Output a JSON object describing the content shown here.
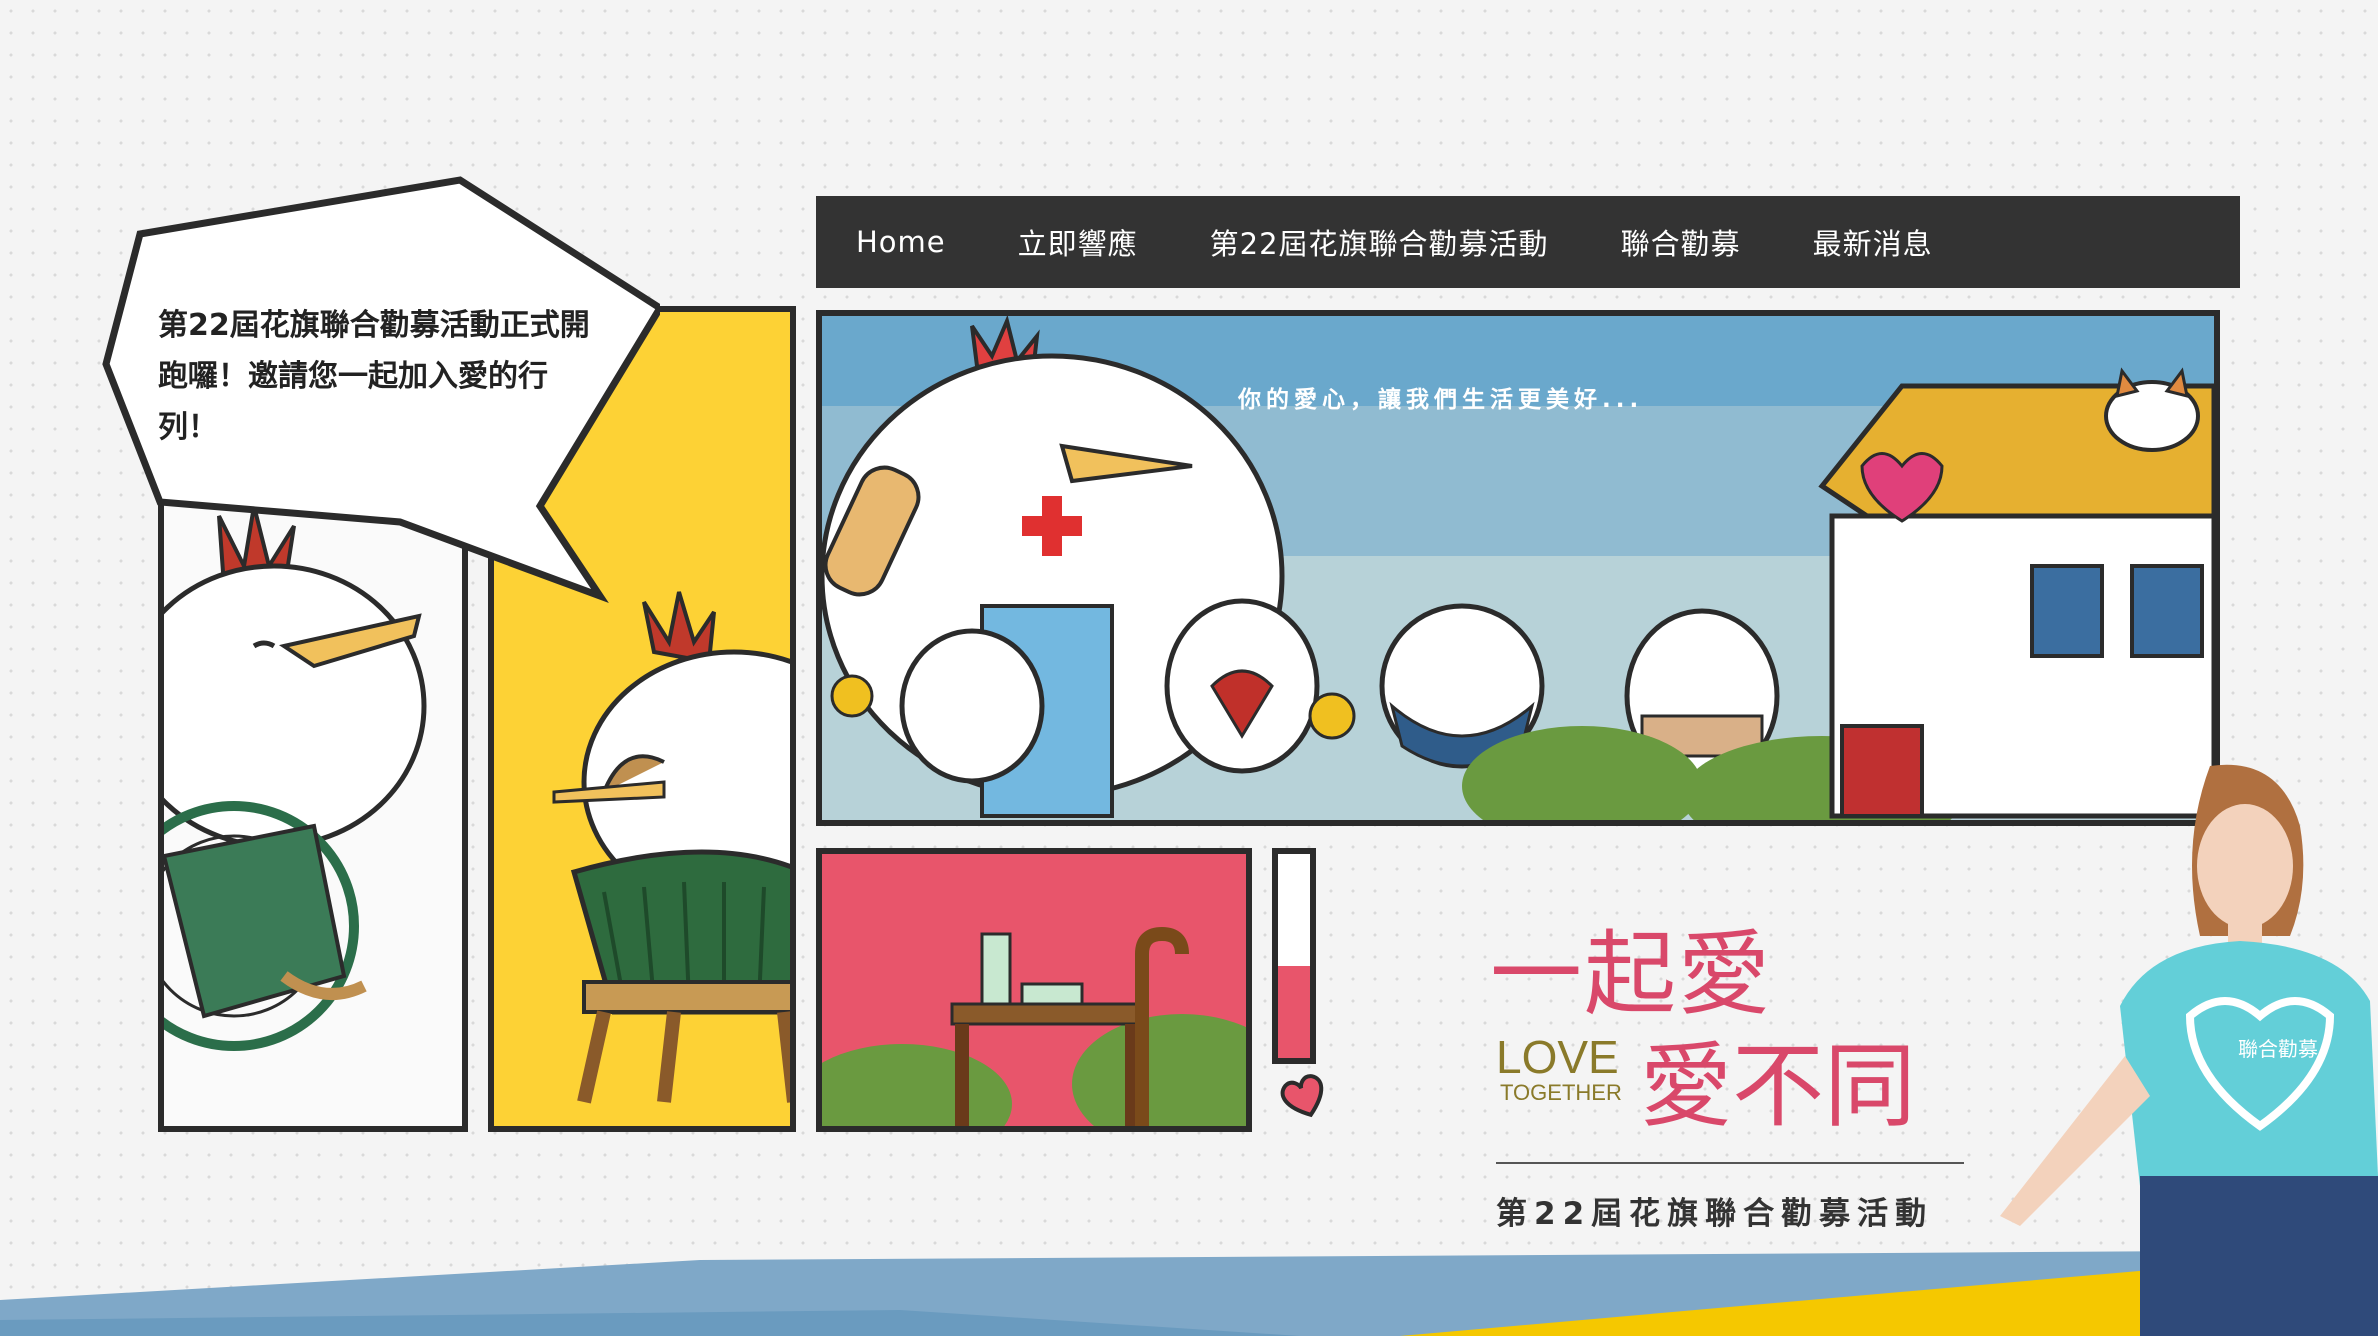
{
  "nav": {
    "items": [
      {
        "label": "Home"
      },
      {
        "label": "立即響應"
      },
      {
        "label": "第22屆花旗聯合勸募活動"
      },
      {
        "label": "聯合勸募"
      },
      {
        "label": "最新消息"
      }
    ]
  },
  "speech_bubble": {
    "lines": [
      "第22屆花旗聯合勸募活動正式開",
      "跑囉！邀請您一起加入愛的行",
      "列！"
    ]
  },
  "banner": {
    "tagline": "你的愛心，讓我們生活更美好..."
  },
  "logo": {
    "line1": "一起愛",
    "love": "LOVE",
    "together": "TOGETHER",
    "line2": "愛不同"
  },
  "event_title": "第22屆花旗聯合勸募活動",
  "mascot_shirt_text": "聯合勸募",
  "gauge": {
    "level_fraction": 0.45
  },
  "colors": {
    "nav_bg": "#333333",
    "accent_yellow": "#fdd235",
    "accent_pink": "#e8556b",
    "sky_blue": "#6ba8cc",
    "logo_pink": "#d9486a",
    "logo_olive": "#8a7a2a",
    "bottom_yellow": "#f5c800",
    "bottom_blue": "#7fa8c8"
  }
}
